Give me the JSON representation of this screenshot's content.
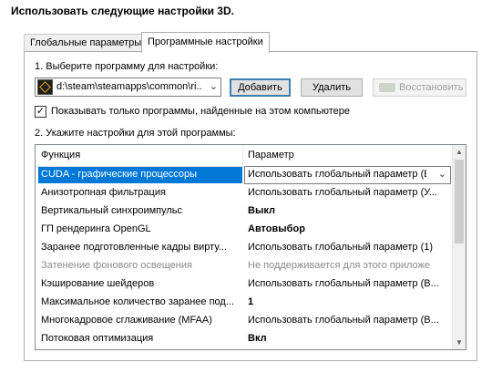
{
  "heading": "Использовать следующие настройки 3D.",
  "tabs": [
    {
      "label": "Глобальные параметры"
    },
    {
      "label": "Программные настройки"
    }
  ],
  "step1": {
    "label": "1. Выберите программу для настройки:",
    "program_value": "d:\\steam\\steamapps\\common\\ri...",
    "add_label": "Добавить",
    "remove_label": "Удалить",
    "restore_label": "Восстановить"
  },
  "checkbox": {
    "label": "Показывать только программы, найденные на этом компьютере",
    "checked": "✓"
  },
  "step2": {
    "label": "2. Укажите настройки для этой программы:"
  },
  "grid": {
    "columns": [
      "Функция",
      "Параметр"
    ],
    "rows": [
      {
        "feature": "CUDA - графические процессоры",
        "value": "Использовать глобальный параметр (Вс"
      },
      {
        "feature": "Анизотропная фильтрация",
        "value": "Использовать глобальный параметр (У..."
      },
      {
        "feature": "Вертикальный синхроимпульс",
        "value": "Выкл"
      },
      {
        "feature": "ГП рендеринга OpenGL",
        "value": "Автовыбор"
      },
      {
        "feature": "Заранее подготовленные кадры вирту...",
        "value": "Использовать глобальный параметр (1)"
      },
      {
        "feature": "Затенение фонового освещения",
        "value": "Не поддерживается для этого приложе"
      },
      {
        "feature": "Кэширование шейдеров",
        "value": "Использовать глобальный параметр (В..."
      },
      {
        "feature": "Максимальное количество заранее под...",
        "value": "1"
      },
      {
        "feature": "Многокадровое сглаживание (MFAA)",
        "value": "Использовать глобальный параметр (В..."
      },
      {
        "feature": "Потоковая оптимизация",
        "value": "Вкл"
      }
    ]
  },
  "colors": {
    "selection": "#0078d7",
    "default_button_border": "#3c7fb1"
  },
  "icons": {
    "program": "game-icon",
    "restore": "nvidia-icon",
    "dropdown": "chevron-down-icon"
  }
}
